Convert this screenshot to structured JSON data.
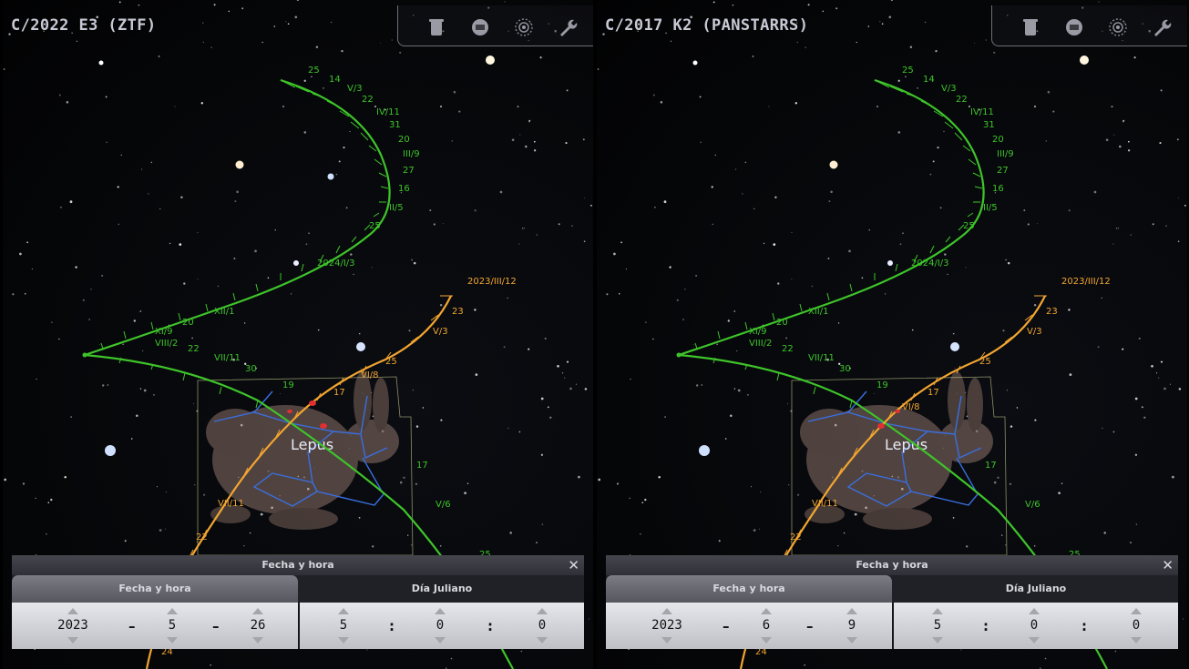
{
  "panes": [
    {
      "title": "C/2022 E3 (ZTF)",
      "dialog": {
        "title": "Fecha y hora",
        "close_label": "✕",
        "tab_date": "Fecha y hora",
        "tab_julian": "Día Juliano",
        "year": "2023",
        "month": "5",
        "day": "26",
        "hour": "5",
        "minute": "0",
        "second": "0",
        "date_sep": "–",
        "time_sep": ":"
      }
    },
    {
      "title": "C/2017 K2 (PANSTARRS)",
      "dialog": {
        "title": "Fecha y hora",
        "close_label": "✕",
        "tab_date": "Fecha y hora",
        "tab_julian": "Día Juliano",
        "year": "2023",
        "month": "6",
        "day": "9",
        "hour": "5",
        "minute": "0",
        "second": "0",
        "date_sep": "–",
        "time_sep": ":"
      }
    }
  ],
  "sky": {
    "constellation": "Lepus",
    "green_labels": [
      "25",
      "14",
      "V/3",
      "22",
      "IV/11",
      "31",
      "20",
      "III/9",
      "27",
      "16",
      "II/5",
      "25",
      "2024/I/3",
      "XII/1",
      "XI/9",
      "20",
      "VIII/2",
      "22",
      "VII/11",
      "30",
      "19",
      "17",
      "V/6",
      "25"
    ],
    "orange_labels": [
      "2023/III/12",
      "23",
      "V/3",
      "25",
      "VI/8",
      "17",
      "VII/11",
      "22",
      "24"
    ],
    "colors": {
      "green_track": "#3ec42a",
      "orange_track": "#f2a531",
      "constellation_lines": "#3a6fe0",
      "boundary": "#c7c98a"
    }
  },
  "icons": [
    "trash-icon",
    "stop-icon",
    "target-icon",
    "wrench-icon"
  ]
}
